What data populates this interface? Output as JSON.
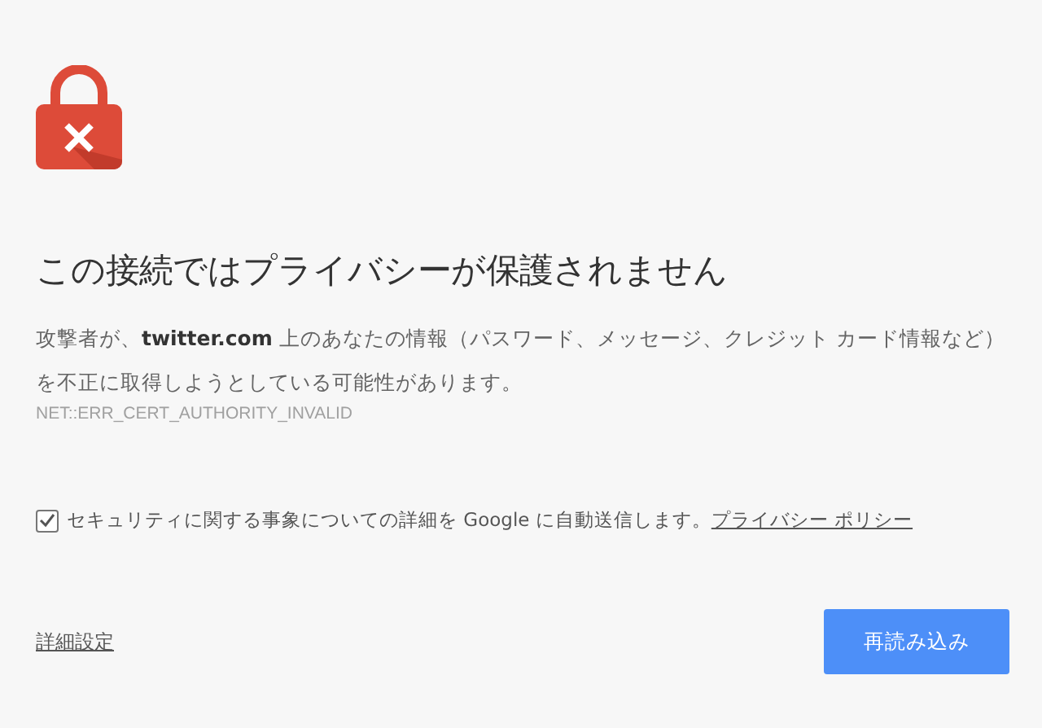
{
  "heading": "この接続ではプライバシーが保護されません",
  "message": "攻撃者が、**twitter.com** 上のあなたの情報（パスワード、メッセージ、クレジット カード情報など）を不正に取得しようとしている可能性があります。",
  "error_code": "NET::ERR_CERT_AUTHORITY_INVALID",
  "report": {
    "checked": true,
    "text": "セキュリティに関する事象についての詳細を Google に自動送信します。",
    "link": "プライバシー ポリシー"
  },
  "advanced_link": "詳細設定",
  "reload_button": "再読み込み"
}
